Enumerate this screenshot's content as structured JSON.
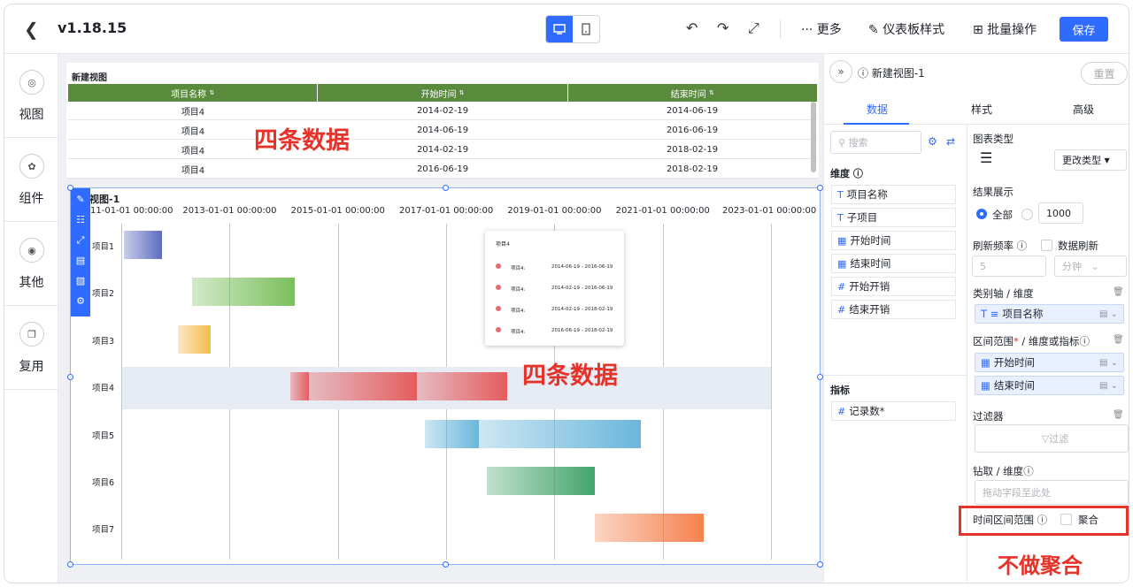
{
  "header": {
    "version": "v1.18.15",
    "more_label": "··· 更多",
    "style_label": "仪表板样式",
    "batch_label": "批量操作",
    "save_label": "保存"
  },
  "leftnav": [
    "视图",
    "组件",
    "其他",
    "复用"
  ],
  "table_view": {
    "title": "新建视图",
    "columns": [
      "项目名称",
      "开始时间",
      "结束时间"
    ],
    "rows": [
      [
        "项目4",
        "2014-02-19",
        "2014-06-19"
      ],
      [
        "项目4",
        "2014-06-19",
        "2016-06-19"
      ],
      [
        "项目4",
        "2014-02-19",
        "2018-02-19"
      ],
      [
        "项目4",
        "2016-06-19",
        "2018-02-19"
      ]
    ],
    "annotation": "四条数据"
  },
  "gantt_view": {
    "title": "建视图-1",
    "annotation": "四条数据",
    "tooltip": {
      "title": "项目4",
      "rows": [
        [
          "项目4:",
          "2014-06-19 - 2016-06-19"
        ],
        [
          "项目4:",
          "2014-02-19 - 2016-06-19"
        ],
        [
          "项目4:",
          "2014-02-19 - 2018-02-19"
        ],
        [
          "项目4:",
          "2016-06-19 - 2018-02-19"
        ]
      ]
    }
  },
  "chart_data": {
    "type": "bar",
    "x_ticks": [
      "11-01-01 00:00:00",
      "2013-01-01 00:00:00",
      "2015-01-01 00:00:00",
      "2017-01-01 00:00:00",
      "2019-01-01 00:00:00",
      "2021-01-01 00:00:00",
      "2023-01-01 00:00:00"
    ],
    "categories": [
      "项目1",
      "项目2",
      "项目3",
      "项目4",
      "项目5",
      "项目6",
      "项目7"
    ],
    "series": [
      {
        "category": "项目1",
        "start": 2011.05,
        "end": 2011.75,
        "color": "#4b5cb8"
      },
      {
        "category": "项目2",
        "start": 2012.3,
        "end": 2014.2,
        "color": "#6bb84a"
      },
      {
        "category": "项目3",
        "start": 2012.05,
        "end": 2012.65,
        "color": "#f2b33a"
      },
      {
        "category": "项目4",
        "start": 2014.13,
        "end": 2014.46,
        "color": "#e34d4d"
      },
      {
        "category": "项目4",
        "start": 2014.46,
        "end": 2016.46,
        "color": "#e34d4d"
      },
      {
        "category": "项目4",
        "start": 2016.46,
        "end": 2018.13,
        "color": "#e34d4d"
      },
      {
        "category": "项目5",
        "start": 2016.6,
        "end": 2017.6,
        "color": "#5aaed6"
      },
      {
        "category": "项目5",
        "start": 2017.6,
        "end": 2020.6,
        "color": "#5aaed6"
      },
      {
        "category": "项目6",
        "start": 2017.75,
        "end": 2019.75,
        "color": "#2e9b5b"
      },
      {
        "category": "项目7",
        "start": 2019.75,
        "end": 2021.75,
        "color": "#f4733a"
      }
    ]
  },
  "fields_panel": {
    "title": "新建视图-1",
    "reset_label": "重置",
    "tabs": [
      "数据",
      "样式",
      "高级"
    ],
    "search_placeholder": "搜索",
    "dimension_label": "维度",
    "dimensions": [
      "项目名称",
      "子项目",
      "开始时间",
      "结束时间",
      "开始开销",
      "结束开销"
    ],
    "measure_label": "指标",
    "measures": [
      "记录数*"
    ]
  },
  "settings_panel": {
    "chart_type_label": "图表类型",
    "change_type_label": "更改类型",
    "result_label": "结果展示",
    "result_all": "全部",
    "result_count": "1000",
    "refresh_label": "刷新频率",
    "data_refresh_label": "数据刷新",
    "refresh_value": "5",
    "refresh_unit": "分钟",
    "category_axis_label": "类别轴 / 维度",
    "category_field": "项目名称",
    "range_label": "区间范围",
    "range_suffix": "/ 维度或指标",
    "range_fields": [
      "开始时间",
      "结束时间"
    ],
    "filter_label": "过滤器",
    "filter_placeholder": "过滤",
    "drill_label": "钻取 / 维度",
    "drill_placeholder": "拖动字段至此处",
    "time_range_label": "时间区间范围",
    "aggregate_label": "聚合",
    "annotation": "不做聚合"
  }
}
